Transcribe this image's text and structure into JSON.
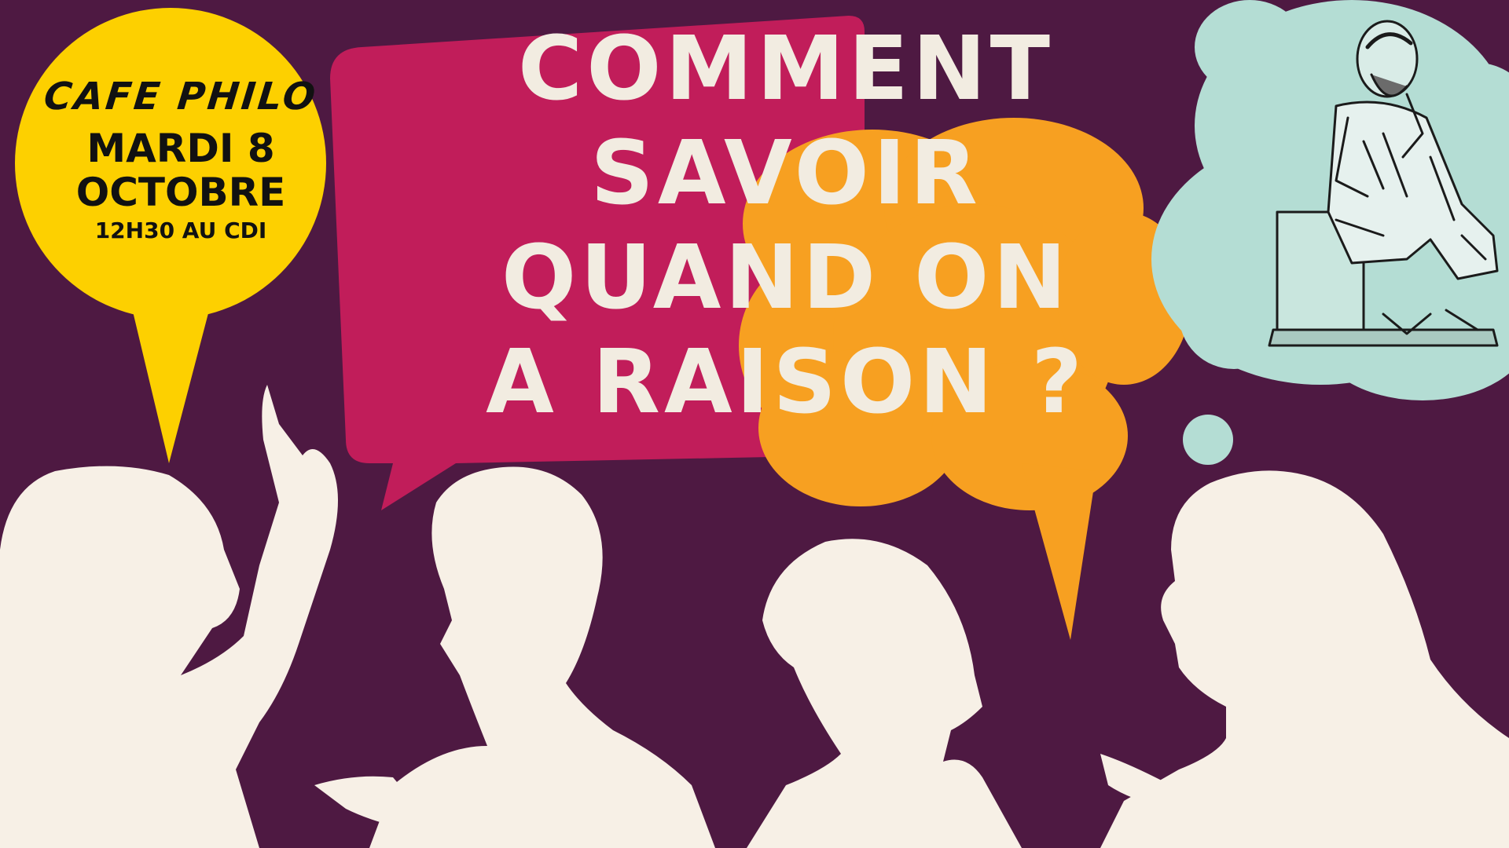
{
  "event": {
    "kicker": "CAFE PHILO",
    "date_line1": "MARDI 8",
    "date_line2": "OCTOBRE",
    "time_place": "12H30 AU CDI"
  },
  "headline": {
    "line1": "COMMENT",
    "line2": "SAVOIR",
    "line3": "QUAND ON",
    "line4": "A RAISON ?"
  },
  "colors": {
    "background": "#4e1942",
    "bubble_yellow": "#fdd000",
    "bubble_magenta": "#c11d5a",
    "bubble_orange": "#f7a021",
    "bubble_mint": "#b4ddd4",
    "silhouette": "#f7f0e6",
    "headline_text": "#f2ece1"
  },
  "icons": {
    "philosopher": "thinking-philosopher-statue"
  }
}
